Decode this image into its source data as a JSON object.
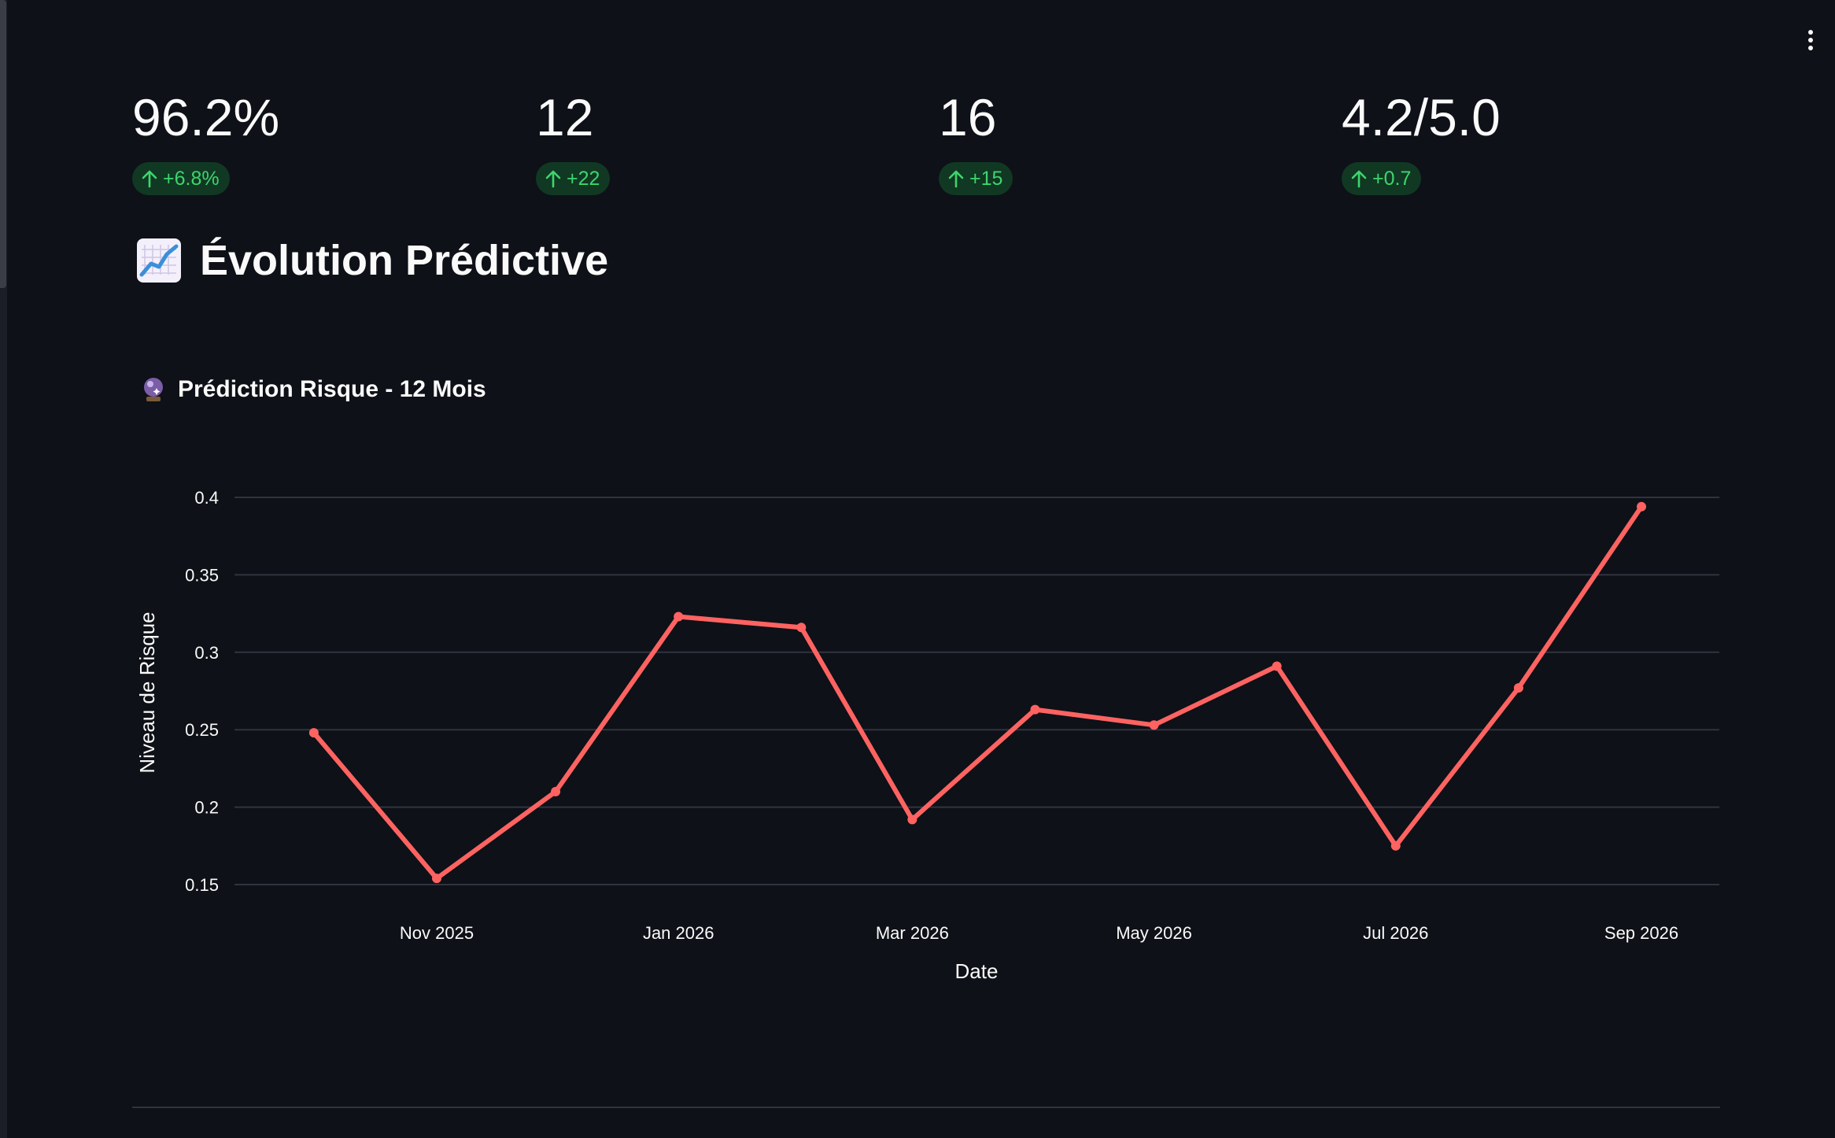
{
  "metrics": [
    {
      "value": "96.2%",
      "delta": "+6.8%"
    },
    {
      "value": "12",
      "delta": "+22"
    },
    {
      "value": "16",
      "delta": "+15"
    },
    {
      "value": "4.2/5.0",
      "delta": "+0.7"
    }
  ],
  "section": {
    "heading": "Évolution Prédictive",
    "icon": "chart-increasing-icon"
  },
  "chart": {
    "title": "Prédiction Risque - 12 Mois",
    "icon": "crystal-ball-icon"
  },
  "colors": {
    "background": "#0e1117",
    "text": "#fafafa",
    "delta_text": "#3dd56d",
    "line": "#ff6361",
    "grid": "#31333f"
  },
  "chart_data": {
    "type": "line",
    "title": "Prédiction Risque - 12 Mois",
    "xlabel": "Date",
    "ylabel": "Niveau de Risque",
    "x": [
      "2025-10-01",
      "2025-11-01",
      "2025-12-01",
      "2026-01-01",
      "2026-02-01",
      "2026-03-01",
      "2026-04-01",
      "2026-05-01",
      "2026-06-01",
      "2026-07-01",
      "2026-08-01",
      "2026-09-01"
    ],
    "series": [
      {
        "values": [
          0.248,
          0.154,
          0.21,
          0.323,
          0.316,
          0.192,
          0.263,
          0.253,
          0.291,
          0.175,
          0.277,
          0.394
        ]
      }
    ],
    "xticks": [
      "Nov 2025",
      "Jan 2026",
      "Mar 2026",
      "May 2026",
      "Jul 2026",
      "Sep 2026"
    ],
    "yticks": [
      "0.15",
      "0.2",
      "0.25",
      "0.3",
      "0.35",
      "0.4"
    ],
    "ylim": [
      0.15,
      0.4
    ],
    "grid": true,
    "legend": "none"
  }
}
